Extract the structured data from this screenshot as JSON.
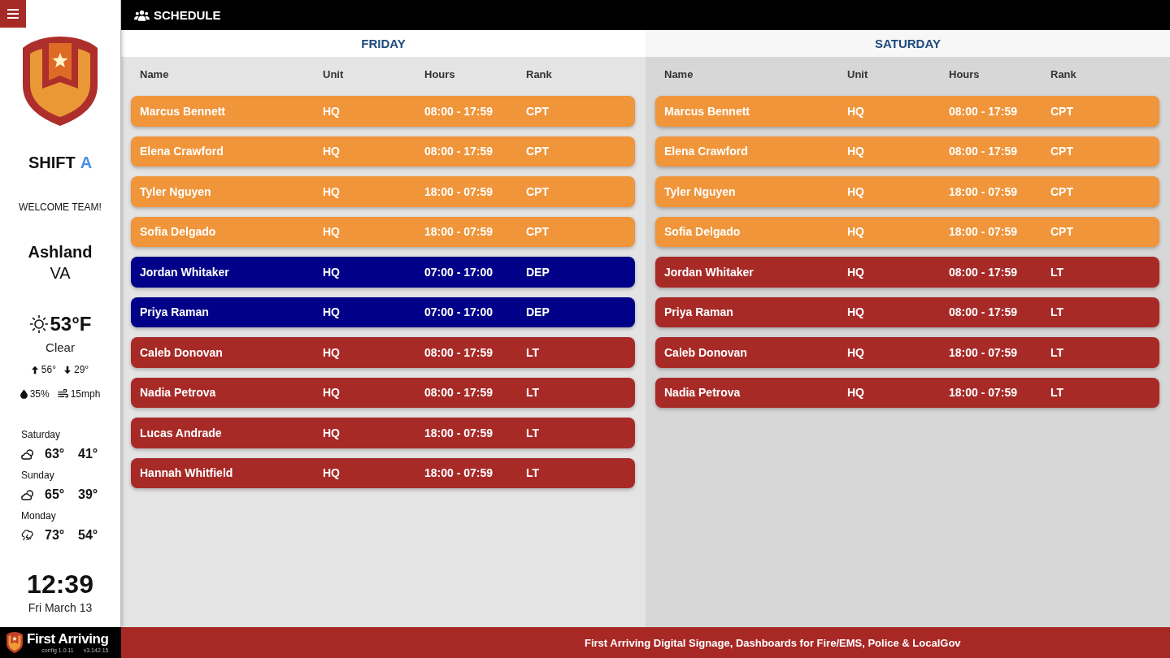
{
  "sidebar": {
    "shift": {
      "label": "SHIFT",
      "value": "A"
    },
    "welcome": "WELCOME TEAM!",
    "location": {
      "city": "Ashland",
      "state": "VA"
    },
    "weather": {
      "temperature": "53°F",
      "condition": "Clear",
      "high": "56°",
      "low": "29°",
      "humidity": "35%",
      "wind": "15mph"
    },
    "forecast": [
      {
        "day": "Saturday",
        "kind": "partly-cloudy",
        "high": "63°",
        "low": "41°"
      },
      {
        "day": "Sunday",
        "kind": "partly-cloudy",
        "high": "65°",
        "low": "39°"
      },
      {
        "day": "Monday",
        "kind": "storm",
        "high": "73°",
        "low": "54°"
      }
    ],
    "clock": {
      "time": "12:39",
      "date": "Fri March 13"
    }
  },
  "header": {
    "title": "SCHEDULE"
  },
  "days": [
    {
      "title": "FRIDAY",
      "columns": [
        "Name",
        "Unit",
        "Hours",
        "Rank"
      ],
      "rows": [
        {
          "name": "Marcus Bennett",
          "unit": "HQ",
          "hours": "08:00 - 17:59",
          "rank": "CPT",
          "color": "#f0953a"
        },
        {
          "name": "Elena Crawford",
          "unit": "HQ",
          "hours": "08:00 - 17:59",
          "rank": "CPT",
          "color": "#f0953a"
        },
        {
          "name": "Tyler Nguyen",
          "unit": "HQ",
          "hours": "18:00 - 07:59",
          "rank": "CPT",
          "color": "#f0953a"
        },
        {
          "name": "Sofia Delgado",
          "unit": "HQ",
          "hours": "18:00 - 07:59",
          "rank": "CPT",
          "color": "#f0953a"
        },
        {
          "name": "Jordan Whitaker",
          "unit": "HQ",
          "hours": "07:00 - 17:00",
          "rank": "DEP",
          "color": "#000088"
        },
        {
          "name": "Priya Raman",
          "unit": "HQ",
          "hours": "07:00 - 17:00",
          "rank": "DEP",
          "color": "#000088"
        },
        {
          "name": "Caleb Donovan",
          "unit": "HQ",
          "hours": "08:00 - 17:59",
          "rank": "LT",
          "color": "#a82a27"
        },
        {
          "name": "Nadia Petrova",
          "unit": "HQ",
          "hours": "08:00 - 17:59",
          "rank": "LT",
          "color": "#a82a27"
        },
        {
          "name": "Lucas Andrade",
          "unit": "HQ",
          "hours": "18:00 - 07:59",
          "rank": "LT",
          "color": "#a82a27"
        },
        {
          "name": "Hannah Whitfield",
          "unit": "HQ",
          "hours": "18:00 - 07:59",
          "rank": "LT",
          "color": "#a82a27"
        }
      ]
    },
    {
      "title": "SATURDAY",
      "columns": [
        "Name",
        "Unit",
        "Hours",
        "Rank"
      ],
      "rows": [
        {
          "name": "Marcus Bennett",
          "unit": "HQ",
          "hours": "08:00 - 17:59",
          "rank": "CPT",
          "color": "#f0953a"
        },
        {
          "name": "Elena Crawford",
          "unit": "HQ",
          "hours": "08:00 - 17:59",
          "rank": "CPT",
          "color": "#f0953a"
        },
        {
          "name": "Tyler Nguyen",
          "unit": "HQ",
          "hours": "18:00 - 07:59",
          "rank": "CPT",
          "color": "#f0953a"
        },
        {
          "name": "Sofia Delgado",
          "unit": "HQ",
          "hours": "18:00 - 07:59",
          "rank": "CPT",
          "color": "#f0953a"
        },
        {
          "name": "Jordan Whitaker",
          "unit": "HQ",
          "hours": "08:00 - 17:59",
          "rank": "LT",
          "color": "#a82a27"
        },
        {
          "name": "Priya Raman",
          "unit": "HQ",
          "hours": "08:00 - 17:59",
          "rank": "LT",
          "color": "#a82a27"
        },
        {
          "name": "Caleb Donovan",
          "unit": "HQ",
          "hours": "18:00 - 07:59",
          "rank": "LT",
          "color": "#a82a27"
        },
        {
          "name": "Nadia Petrova",
          "unit": "HQ",
          "hours": "18:00 - 07:59",
          "rank": "LT",
          "color": "#a82a27"
        }
      ]
    }
  ],
  "brand": {
    "name": "First Arriving",
    "config": "config 1.0.11",
    "version": "v3.142.15"
  },
  "footer": {
    "text": "First Arriving Digital Signage, Dashboards for Fire/EMS, Police & LocalGov"
  }
}
